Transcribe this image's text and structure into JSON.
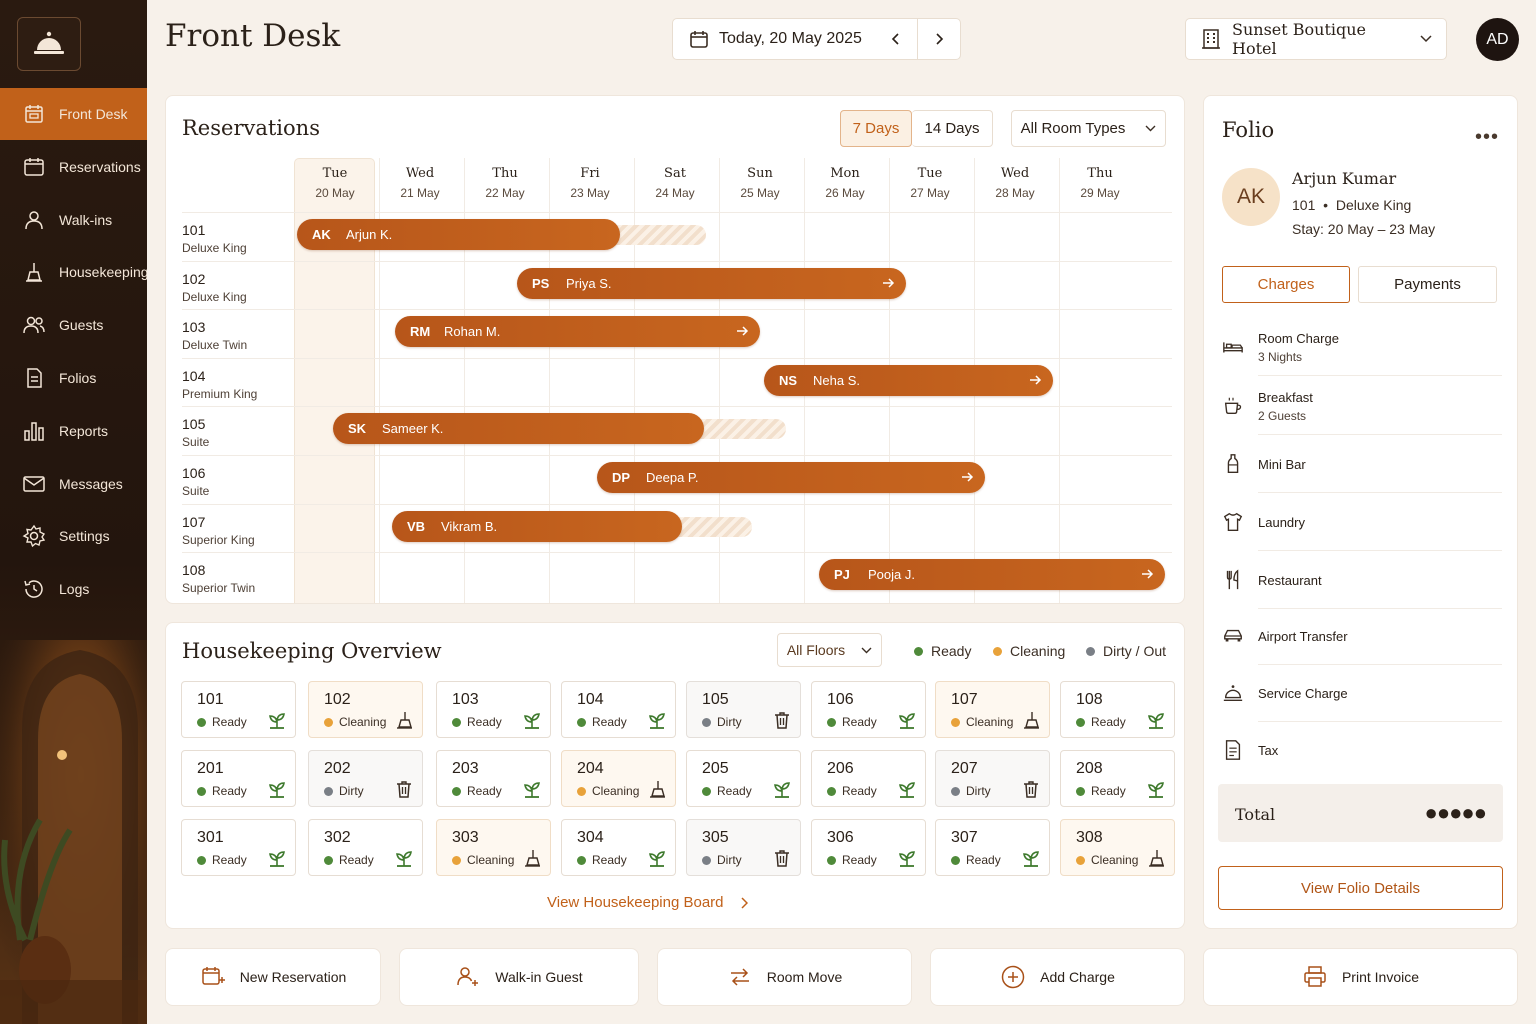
{
  "app": {
    "page_title": "Front Desk"
  },
  "sidebar": {
    "items": [
      {
        "label": "Front Desk",
        "icon": "front-desk-icon",
        "active": true
      },
      {
        "label": "Reservations",
        "icon": "calendar-icon"
      },
      {
        "label": "Walk-ins",
        "icon": "person-icon"
      },
      {
        "label": "Housekeeping",
        "icon": "broom-icon"
      },
      {
        "label": "Guests",
        "icon": "guests-icon"
      },
      {
        "label": "Folios",
        "icon": "document-icon"
      },
      {
        "label": "Reports",
        "icon": "bar-chart-icon"
      },
      {
        "label": "Messages",
        "icon": "envelope-icon"
      },
      {
        "label": "Settings",
        "icon": "gear-icon"
      },
      {
        "label": "Logs",
        "icon": "history-icon"
      }
    ]
  },
  "header": {
    "date_label": "Today, 20 May 2025",
    "hotel": "Sunset Boutique Hotel",
    "user_initials": "AD"
  },
  "reservations": {
    "title": "Reservations",
    "range_options": [
      "7 Days",
      "14 Days"
    ],
    "selected_range": "7 Days",
    "room_type_filter": "All Room Types",
    "days": [
      {
        "weekday": "Tue",
        "date": "20 May",
        "today": true
      },
      {
        "weekday": "Wed",
        "date": "21 May"
      },
      {
        "weekday": "Thu",
        "date": "22 May"
      },
      {
        "weekday": "Fri",
        "date": "23 May"
      },
      {
        "weekday": "Sat",
        "date": "24 May"
      },
      {
        "weekday": "Sun",
        "date": "25 May"
      },
      {
        "weekday": "Mon",
        "date": "26 May"
      },
      {
        "weekday": "Tue",
        "date": "27 May"
      },
      {
        "weekday": "Wed",
        "date": "28 May"
      },
      {
        "weekday": "Thu",
        "date": "29 May"
      }
    ],
    "rooms": [
      {
        "number": "101",
        "type": "Deluxe King"
      },
      {
        "number": "102",
        "type": "Deluxe King"
      },
      {
        "number": "103",
        "type": "Deluxe Twin"
      },
      {
        "number": "104",
        "type": "Premium King"
      },
      {
        "number": "105",
        "type": "Suite"
      },
      {
        "number": "106",
        "type": "Suite"
      },
      {
        "number": "107",
        "type": "Superior King"
      },
      {
        "number": "108",
        "type": "Superior Twin"
      }
    ],
    "bookings": [
      {
        "room": "101",
        "initials": "AK",
        "guest": "Arjun K.",
        "continues": false
      },
      {
        "room": "102",
        "initials": "PS",
        "guest": "Priya S.",
        "continues": true
      },
      {
        "room": "103",
        "initials": "RM",
        "guest": "Rohan M.",
        "continues": true
      },
      {
        "room": "104",
        "initials": "NS",
        "guest": "Neha S.",
        "continues": true
      },
      {
        "room": "105",
        "initials": "SK",
        "guest": "Sameer K.",
        "continues": false
      },
      {
        "room": "106",
        "initials": "DP",
        "guest": "Deepa P.",
        "continues": true
      },
      {
        "room": "107",
        "initials": "VB",
        "guest": "Vikram B.",
        "continues": false
      },
      {
        "room": "108",
        "initials": "PJ",
        "guest": "Pooja J.",
        "continues": true
      }
    ]
  },
  "housekeeping": {
    "title": "Housekeeping Overview",
    "floor_filter": "All Floors",
    "legend": [
      {
        "label": "Ready",
        "color": "#4f8a3a"
      },
      {
        "label": "Cleaning",
        "color": "#e8a23a"
      },
      {
        "label": "Dirty / Out",
        "color": "#7a7f86"
      }
    ],
    "rooms": [
      {
        "number": "101",
        "status": "Ready"
      },
      {
        "number": "102",
        "status": "Cleaning"
      },
      {
        "number": "103",
        "status": "Ready"
      },
      {
        "number": "104",
        "status": "Ready"
      },
      {
        "number": "105",
        "status": "Dirty"
      },
      {
        "number": "106",
        "status": "Ready"
      },
      {
        "number": "107",
        "status": "Cleaning"
      },
      {
        "number": "108",
        "status": "Ready"
      },
      {
        "number": "201",
        "status": "Ready"
      },
      {
        "number": "202",
        "status": "Dirty"
      },
      {
        "number": "203",
        "status": "Ready"
      },
      {
        "number": "204",
        "status": "Cleaning"
      },
      {
        "number": "205",
        "status": "Ready"
      },
      {
        "number": "206",
        "status": "Ready"
      },
      {
        "number": "207",
        "status": "Dirty"
      },
      {
        "number": "208",
        "status": "Ready"
      },
      {
        "number": "301",
        "status": "Ready"
      },
      {
        "number": "302",
        "status": "Ready"
      },
      {
        "number": "303",
        "status": "Cleaning"
      },
      {
        "number": "304",
        "status": "Ready"
      },
      {
        "number": "305",
        "status": "Dirty"
      },
      {
        "number": "306",
        "status": "Ready"
      },
      {
        "number": "307",
        "status": "Ready"
      },
      {
        "number": "308",
        "status": "Cleaning"
      }
    ],
    "link_label": "View Housekeeping Board"
  },
  "folio": {
    "title": "Folio",
    "guest_initials": "AK",
    "guest_name": "Arjun Kumar",
    "room_number": "101",
    "room_type": "Deluxe King",
    "stay": "Stay: 20 May – 23 May",
    "tabs": [
      "Charges",
      "Payments"
    ],
    "active_tab": "Charges",
    "charges": [
      {
        "name": "Room Charge",
        "detail": "3 Nights",
        "icon": "bed-icon"
      },
      {
        "name": "Breakfast",
        "detail": "2 Guests",
        "icon": "coffee-cup-icon"
      },
      {
        "name": "Mini Bar",
        "detail": "",
        "icon": "bottle-icon"
      },
      {
        "name": "Laundry",
        "detail": "",
        "icon": "shirt-icon"
      },
      {
        "name": "Restaurant",
        "detail": "",
        "icon": "fork-knife-icon"
      },
      {
        "name": "Airport Transfer",
        "detail": "",
        "icon": "car-icon"
      },
      {
        "name": "Service Charge",
        "detail": "",
        "icon": "service-bell-icon"
      },
      {
        "name": "Tax",
        "detail": "",
        "icon": "receipt-icon"
      }
    ],
    "total_label": "Total",
    "total_value": "●●●●●",
    "details_button": "View Folio Details"
  },
  "actions": [
    {
      "label": "New Reservation",
      "icon": "calendar-plus-icon"
    },
    {
      "label": "Walk-in Guest",
      "icon": "person-plus-icon"
    },
    {
      "label": "Room Move",
      "icon": "swap-arrows-icon"
    },
    {
      "label": "Add Charge",
      "icon": "plus-circle-icon"
    },
    {
      "label": "Print Invoice",
      "icon": "printer-icon"
    }
  ],
  "colors": {
    "accent": "#c1611a",
    "sidebar": "#23150d",
    "ready": "#4f8a3a",
    "cleaning": "#e8a23a",
    "dirty": "#7a7f86"
  }
}
